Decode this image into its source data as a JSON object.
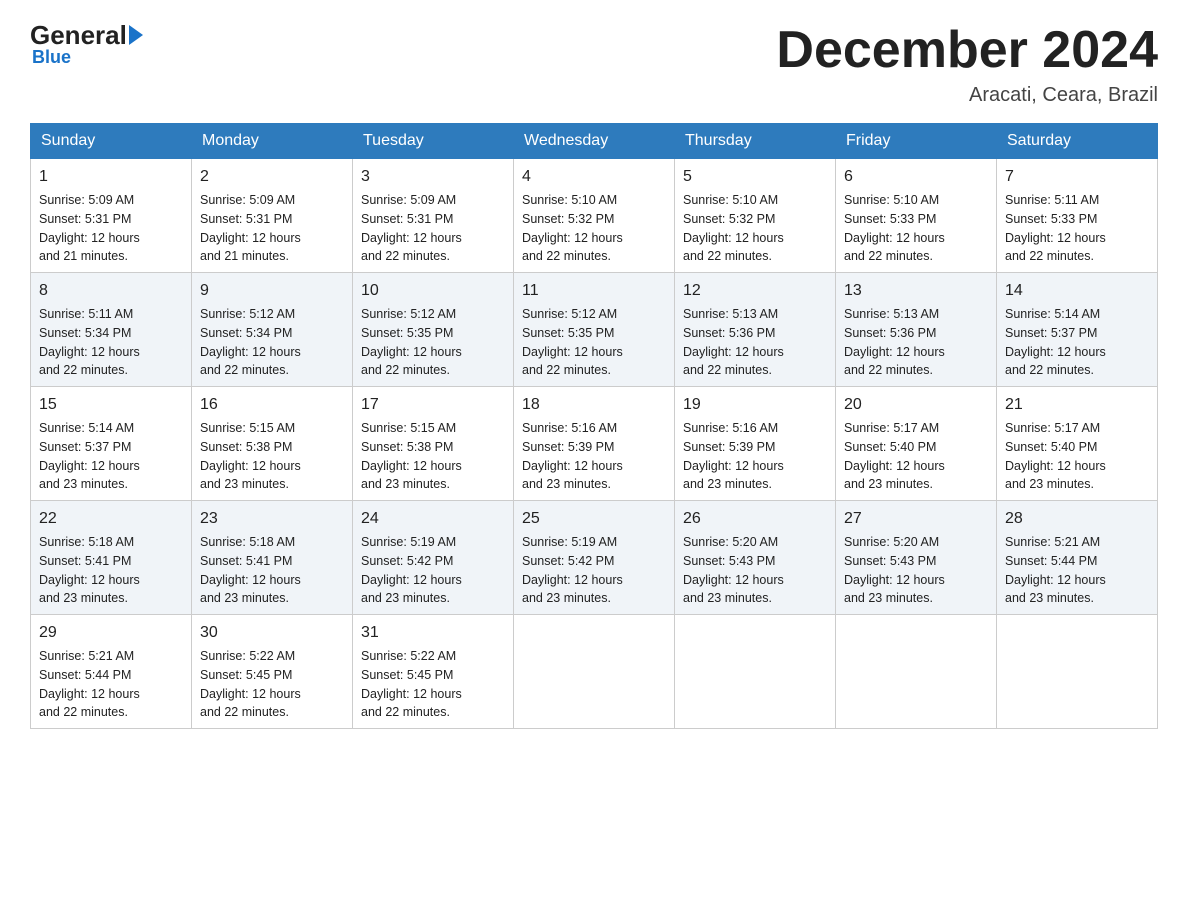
{
  "header": {
    "logo_general": "General",
    "logo_blue": "Blue",
    "month": "December 2024",
    "location": "Aracati, Ceara, Brazil"
  },
  "days_of_week": [
    "Sunday",
    "Monday",
    "Tuesday",
    "Wednesday",
    "Thursday",
    "Friday",
    "Saturday"
  ],
  "weeks": [
    [
      {
        "day": "1",
        "sunrise": "5:09 AM",
        "sunset": "5:31 PM",
        "daylight": "12 hours and 21 minutes."
      },
      {
        "day": "2",
        "sunrise": "5:09 AM",
        "sunset": "5:31 PM",
        "daylight": "12 hours and 21 minutes."
      },
      {
        "day": "3",
        "sunrise": "5:09 AM",
        "sunset": "5:31 PM",
        "daylight": "12 hours and 22 minutes."
      },
      {
        "day": "4",
        "sunrise": "5:10 AM",
        "sunset": "5:32 PM",
        "daylight": "12 hours and 22 minutes."
      },
      {
        "day": "5",
        "sunrise": "5:10 AM",
        "sunset": "5:32 PM",
        "daylight": "12 hours and 22 minutes."
      },
      {
        "day": "6",
        "sunrise": "5:10 AM",
        "sunset": "5:33 PM",
        "daylight": "12 hours and 22 minutes."
      },
      {
        "day": "7",
        "sunrise": "5:11 AM",
        "sunset": "5:33 PM",
        "daylight": "12 hours and 22 minutes."
      }
    ],
    [
      {
        "day": "8",
        "sunrise": "5:11 AM",
        "sunset": "5:34 PM",
        "daylight": "12 hours and 22 minutes."
      },
      {
        "day": "9",
        "sunrise": "5:12 AM",
        "sunset": "5:34 PM",
        "daylight": "12 hours and 22 minutes."
      },
      {
        "day": "10",
        "sunrise": "5:12 AM",
        "sunset": "5:35 PM",
        "daylight": "12 hours and 22 minutes."
      },
      {
        "day": "11",
        "sunrise": "5:12 AM",
        "sunset": "5:35 PM",
        "daylight": "12 hours and 22 minutes."
      },
      {
        "day": "12",
        "sunrise": "5:13 AM",
        "sunset": "5:36 PM",
        "daylight": "12 hours and 22 minutes."
      },
      {
        "day": "13",
        "sunrise": "5:13 AM",
        "sunset": "5:36 PM",
        "daylight": "12 hours and 22 minutes."
      },
      {
        "day": "14",
        "sunrise": "5:14 AM",
        "sunset": "5:37 PM",
        "daylight": "12 hours and 22 minutes."
      }
    ],
    [
      {
        "day": "15",
        "sunrise": "5:14 AM",
        "sunset": "5:37 PM",
        "daylight": "12 hours and 23 minutes."
      },
      {
        "day": "16",
        "sunrise": "5:15 AM",
        "sunset": "5:38 PM",
        "daylight": "12 hours and 23 minutes."
      },
      {
        "day": "17",
        "sunrise": "5:15 AM",
        "sunset": "5:38 PM",
        "daylight": "12 hours and 23 minutes."
      },
      {
        "day": "18",
        "sunrise": "5:16 AM",
        "sunset": "5:39 PM",
        "daylight": "12 hours and 23 minutes."
      },
      {
        "day": "19",
        "sunrise": "5:16 AM",
        "sunset": "5:39 PM",
        "daylight": "12 hours and 23 minutes."
      },
      {
        "day": "20",
        "sunrise": "5:17 AM",
        "sunset": "5:40 PM",
        "daylight": "12 hours and 23 minutes."
      },
      {
        "day": "21",
        "sunrise": "5:17 AM",
        "sunset": "5:40 PM",
        "daylight": "12 hours and 23 minutes."
      }
    ],
    [
      {
        "day": "22",
        "sunrise": "5:18 AM",
        "sunset": "5:41 PM",
        "daylight": "12 hours and 23 minutes."
      },
      {
        "day": "23",
        "sunrise": "5:18 AM",
        "sunset": "5:41 PM",
        "daylight": "12 hours and 23 minutes."
      },
      {
        "day": "24",
        "sunrise": "5:19 AM",
        "sunset": "5:42 PM",
        "daylight": "12 hours and 23 minutes."
      },
      {
        "day": "25",
        "sunrise": "5:19 AM",
        "sunset": "5:42 PM",
        "daylight": "12 hours and 23 minutes."
      },
      {
        "day": "26",
        "sunrise": "5:20 AM",
        "sunset": "5:43 PM",
        "daylight": "12 hours and 23 minutes."
      },
      {
        "day": "27",
        "sunrise": "5:20 AM",
        "sunset": "5:43 PM",
        "daylight": "12 hours and 23 minutes."
      },
      {
        "day": "28",
        "sunrise": "5:21 AM",
        "sunset": "5:44 PM",
        "daylight": "12 hours and 23 minutes."
      }
    ],
    [
      {
        "day": "29",
        "sunrise": "5:21 AM",
        "sunset": "5:44 PM",
        "daylight": "12 hours and 22 minutes."
      },
      {
        "day": "30",
        "sunrise": "5:22 AM",
        "sunset": "5:45 PM",
        "daylight": "12 hours and 22 minutes."
      },
      {
        "day": "31",
        "sunrise": "5:22 AM",
        "sunset": "5:45 PM",
        "daylight": "12 hours and 22 minutes."
      },
      null,
      null,
      null,
      null
    ]
  ],
  "labels": {
    "sunrise": "Sunrise:",
    "sunset": "Sunset:",
    "daylight": "Daylight:"
  }
}
